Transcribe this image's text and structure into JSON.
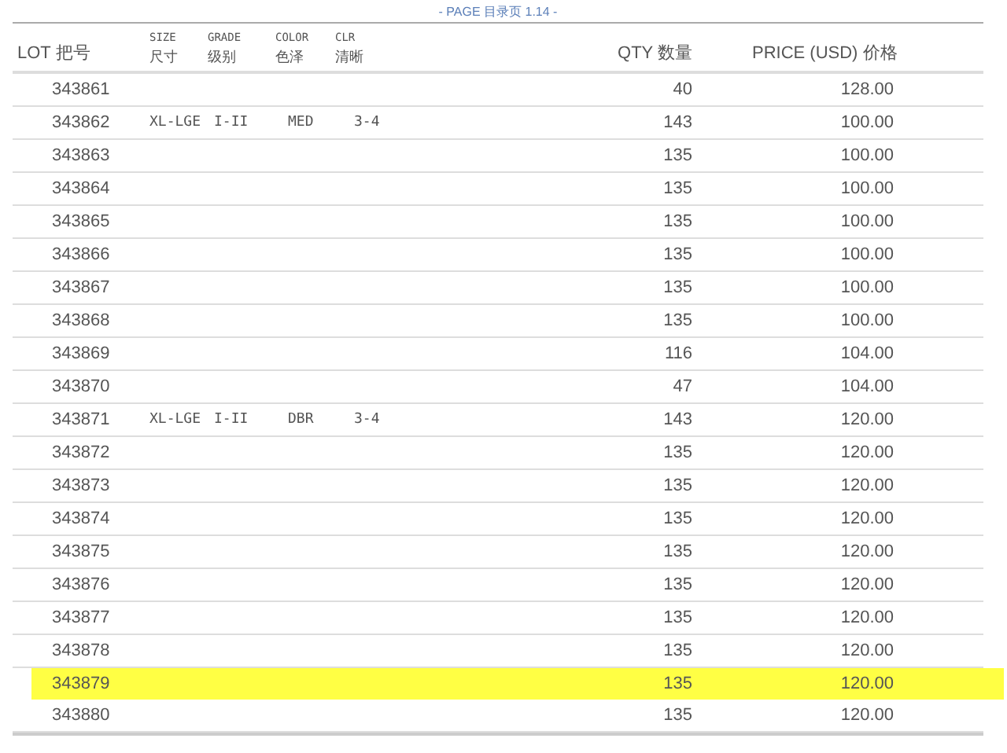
{
  "page_label": "- PAGE 目录页 1.14 -",
  "columns": [
    {
      "en": "LOT",
      "zh": "把号"
    },
    {
      "en": "SIZE",
      "zh": "尺寸"
    },
    {
      "en": "GRADE",
      "zh": "级别"
    },
    {
      "en": "COLOR",
      "zh": "色泽"
    },
    {
      "en": "CLR",
      "zh": "清晰"
    },
    {
      "en": "QTY",
      "zh": "数量"
    },
    {
      "en": "PRICE (USD)",
      "zh": "价格"
    }
  ],
  "rows": [
    {
      "lot": "343861",
      "qty": "40",
      "price": "128.00",
      "selected": false
    },
    {
      "lot": "343862",
      "size": "XL-LGE",
      "grade": "I-II",
      "shade": "MED",
      "clr": "3-4",
      "qty": "143",
      "price": "100.00",
      "selected": false
    },
    {
      "lot": "343863",
      "qty": "135",
      "price": "100.00",
      "selected": false
    },
    {
      "lot": "343864",
      "qty": "135",
      "price": "100.00",
      "selected": false
    },
    {
      "lot": "343865",
      "qty": "135",
      "price": "100.00",
      "selected": false
    },
    {
      "lot": "343866",
      "qty": "135",
      "price": "100.00",
      "selected": false
    },
    {
      "lot": "343867",
      "qty": "135",
      "price": "100.00",
      "selected": false
    },
    {
      "lot": "343868",
      "qty": "135",
      "price": "100.00",
      "selected": false
    },
    {
      "lot": "343869",
      "qty": "116",
      "price": "104.00",
      "selected": false
    },
    {
      "lot": "343870",
      "qty": "47",
      "price": "104.00",
      "selected": false
    },
    {
      "lot": "343871",
      "size": "XL-LGE",
      "grade": "I-II",
      "shade": "DBR",
      "clr": "3-4",
      "qty": "143",
      "price": "120.00",
      "selected": false
    },
    {
      "lot": "343872",
      "qty": "135",
      "price": "120.00",
      "selected": false
    },
    {
      "lot": "343873",
      "qty": "135",
      "price": "120.00",
      "selected": false
    },
    {
      "lot": "343874",
      "qty": "135",
      "price": "120.00",
      "selected": false
    },
    {
      "lot": "343875",
      "qty": "135",
      "price": "120.00",
      "selected": false
    },
    {
      "lot": "343876",
      "qty": "135",
      "price": "120.00",
      "selected": false
    },
    {
      "lot": "343877",
      "qty": "135",
      "price": "120.00",
      "selected": false
    },
    {
      "lot": "343878",
      "qty": "135",
      "price": "120.00",
      "selected": false
    },
    {
      "lot": "343879",
      "qty": "135",
      "price": "120.00",
      "selected": true
    },
    {
      "lot": "343880",
      "qty": "135",
      "price": "120.00",
      "selected": false
    }
  ]
}
